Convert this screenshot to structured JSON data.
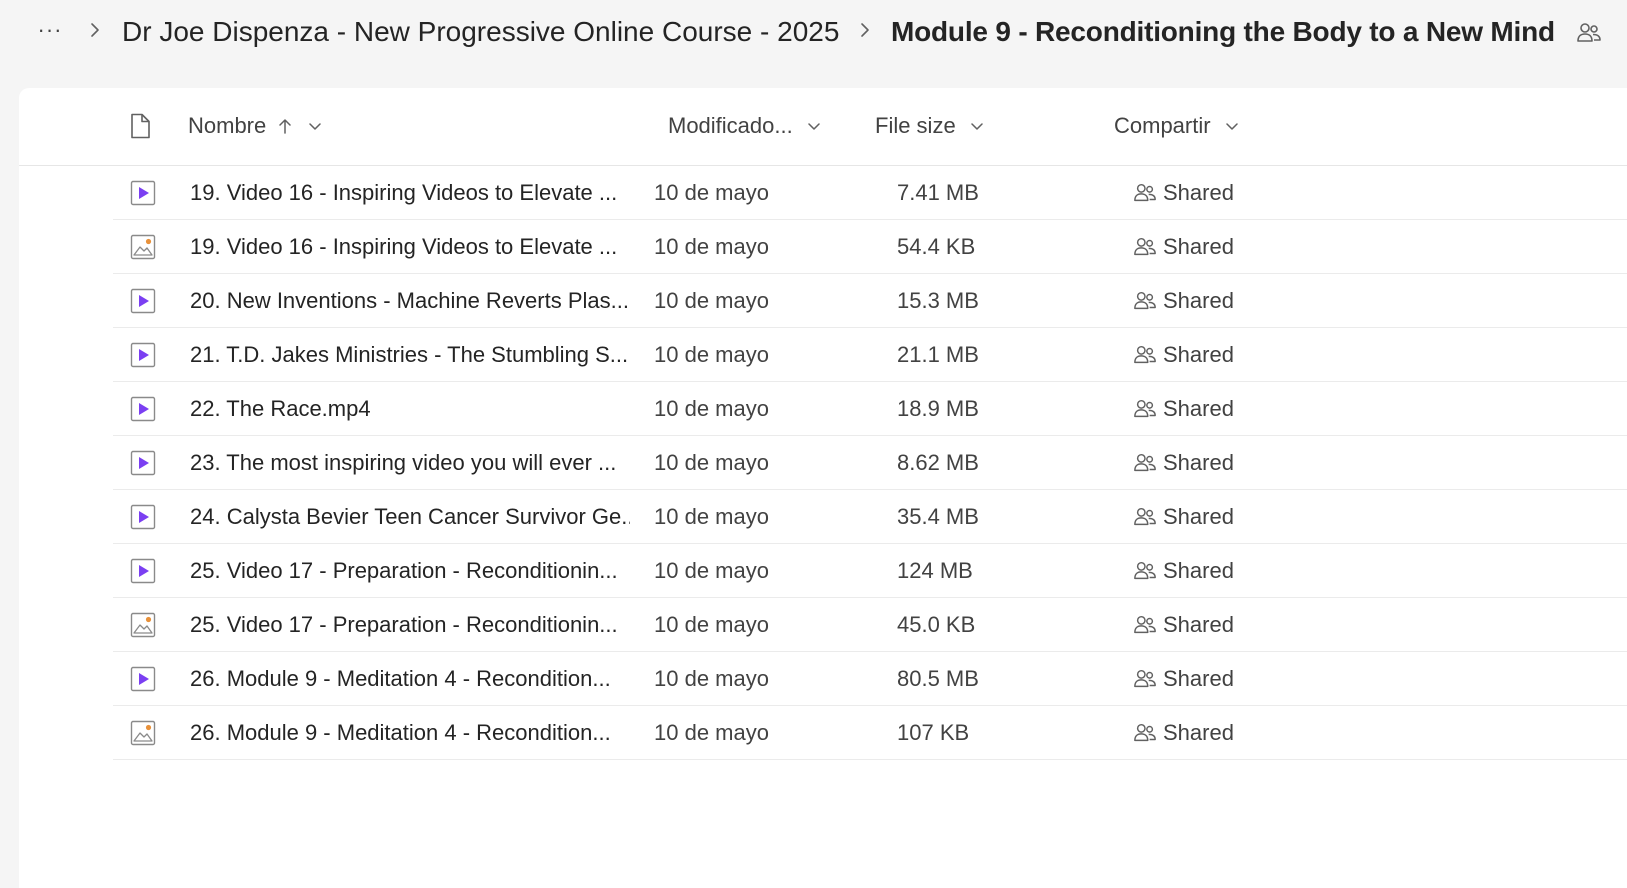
{
  "breadcrumb": {
    "more_label": "···",
    "parent": "Dr Joe Dispenza - New Progressive Online Course - 2025",
    "current": "Module 9 - Reconditioning the Body to a New Mind"
  },
  "columns": {
    "name": "Nombre",
    "modified": "Modificado...",
    "size": "File size",
    "sharing": "Compartir"
  },
  "icons": {
    "more": "more-horizontal-icon",
    "chevron": "chevron-right-icon",
    "people": "people-shared-icon",
    "file": "document-icon",
    "video": "video-file-icon",
    "image": "image-file-icon"
  },
  "colors": {
    "video_accent": "#7b3ff2",
    "image_accent": "#e8913a"
  },
  "files": [
    {
      "type": "video",
      "name": "19. Video 16 - Inspiring Videos to Elevate ...",
      "modified": "10 de mayo",
      "size": "7.41 MB",
      "sharing": "Shared"
    },
    {
      "type": "image",
      "name": "19. Video 16 - Inspiring Videos to Elevate ...",
      "modified": "10 de mayo",
      "size": "54.4 KB",
      "sharing": "Shared"
    },
    {
      "type": "video",
      "name": "20. New Inventions - Machine Reverts Plas...",
      "modified": "10 de mayo",
      "size": "15.3 MB",
      "sharing": "Shared"
    },
    {
      "type": "video",
      "name": "21. T.D. Jakes Ministries - The Stumbling S...",
      "modified": "10 de mayo",
      "size": "21.1 MB",
      "sharing": "Shared"
    },
    {
      "type": "video",
      "name": "22. The Race.mp4",
      "modified": "10 de mayo",
      "size": "18.9 MB",
      "sharing": "Shared"
    },
    {
      "type": "video",
      "name": "23. The most inspiring video you will ever ...",
      "modified": "10 de mayo",
      "size": "8.62 MB",
      "sharing": "Shared"
    },
    {
      "type": "video",
      "name": "24. Calysta Bevier Teen Cancer Survivor Ge...",
      "modified": "10 de mayo",
      "size": "35.4 MB",
      "sharing": "Shared"
    },
    {
      "type": "video",
      "name": "25. Video 17 - Preparation - Reconditionin...",
      "modified": "10 de mayo",
      "size": "124 MB",
      "sharing": "Shared"
    },
    {
      "type": "image",
      "name": "25. Video 17 - Preparation - Reconditionin...",
      "modified": "10 de mayo",
      "size": "45.0 KB",
      "sharing": "Shared"
    },
    {
      "type": "video",
      "name": "26. Module 9 - Meditation 4 - Recondition...",
      "modified": "10 de mayo",
      "size": "80.5 MB",
      "sharing": "Shared"
    },
    {
      "type": "image",
      "name": "26. Module 9 - Meditation 4 - Recondition...",
      "modified": "10 de mayo",
      "size": "107 KB",
      "sharing": "Shared"
    }
  ]
}
